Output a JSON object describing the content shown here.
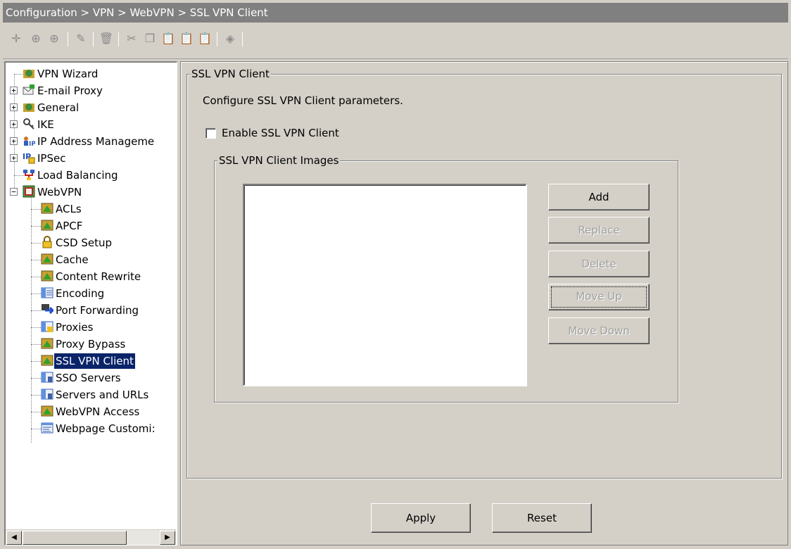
{
  "breadcrumb": "Configuration > VPN > WebVPN > SSL VPN Client",
  "toolbar": {
    "icons": [
      "add-icon",
      "insert-icon",
      "insert-after-icon",
      "edit-icon",
      "delete-icon",
      "cut-icon",
      "copy-icon",
      "paste-icon",
      "paste-insert-icon",
      "paste-after-icon",
      "find-icon"
    ]
  },
  "tree": {
    "items": [
      {
        "label": "VPN Wizard"
      },
      {
        "label": "E-mail Proxy"
      },
      {
        "label": "General"
      },
      {
        "label": "IKE"
      },
      {
        "label": "IP Address Manageme"
      },
      {
        "label": "IPSec"
      },
      {
        "label": "Load Balancing"
      },
      {
        "label": "WebVPN"
      },
      {
        "label": "ACLs"
      },
      {
        "label": "APCF"
      },
      {
        "label": "CSD Setup"
      },
      {
        "label": "Cache"
      },
      {
        "label": "Content Rewrite"
      },
      {
        "label": "Encoding"
      },
      {
        "label": "Port Forwarding"
      },
      {
        "label": "Proxies"
      },
      {
        "label": "Proxy Bypass"
      },
      {
        "label": "SSL VPN Client"
      },
      {
        "label": "SSO Servers"
      },
      {
        "label": "Servers and URLs"
      },
      {
        "label": "WebVPN Access"
      },
      {
        "label": "Webpage Customi:"
      }
    ],
    "selected": "SSL VPN Client"
  },
  "main": {
    "group_title": "SSL VPN Client",
    "description": "Configure SSL VPN Client parameters.",
    "enable_label": "Enable SSL VPN Client",
    "enable_checked": false,
    "images_group_title": "SSL VPN Client Images",
    "buttons": {
      "add": "Add",
      "replace": "Replace",
      "delete": "Delete",
      "move_up": "Move Up",
      "move_down": "Move Down"
    },
    "apply": "Apply",
    "reset": "Reset"
  },
  "colors": {
    "background": "#d4d0c8",
    "titlebar": "#808080",
    "selection": "#0a246a"
  }
}
